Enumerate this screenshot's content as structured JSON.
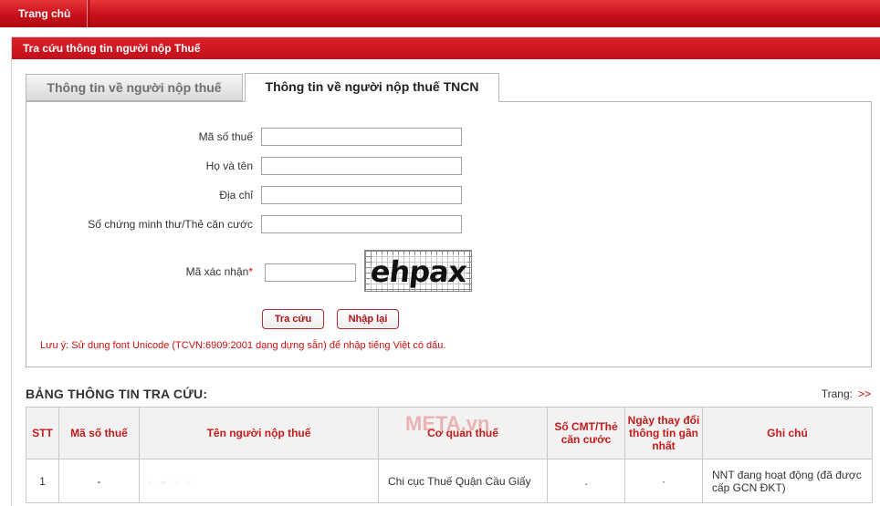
{
  "topnav": {
    "home_label": "Trang chủ"
  },
  "panel": {
    "title": "Tra cứu thông tin người nộp Thuế"
  },
  "tabs": [
    {
      "label": "Thông tin về người nộp thuế",
      "active": false
    },
    {
      "label": "Thông tin về người nộp thuế TNCN",
      "active": true
    }
  ],
  "form": {
    "tax_code_label": "Mã số thuế",
    "tax_code_value": "",
    "full_name_label": "Họ và tên",
    "full_name_value": "",
    "address_label": "Địa chỉ",
    "address_value": "",
    "id_card_label": "Số chứng minh thư/Thẻ căn cước",
    "id_card_value": "",
    "captcha_label": "Mã xác nhận",
    "captcha_required_mark": "*",
    "captcha_input_value": "",
    "captcha_text": "ehpax",
    "search_button": "Tra cứu",
    "reset_button": "Nhập lại",
    "note": "Lưu ý: Sử dụng font Unicode (TCVN:6909:2001 dạng dựng sẵn) để nhập tiếng Việt có dấu."
  },
  "results": {
    "title": "BẢNG THÔNG TIN TRA CỨU:",
    "pager_label": "Trang:",
    "pager_next": ">>",
    "headers": [
      "STT",
      "Mã số thuế",
      "Tên người nộp thuế",
      "Cơ quan thuế",
      "Số CMT/Thẻ căn cước",
      "Ngày thay đổi thông tin gần nhất",
      "Ghi chú"
    ],
    "rows": [
      {
        "stt": "1",
        "tax_code": "-",
        "name": "",
        "tax_office": "Chi cục Thuế Quận Cầu Giấy",
        "id_card": ".",
        "last_changed": "·",
        "note": "NNT đang hoạt động (đã được cấp GCN ĐKT)"
      }
    ]
  },
  "watermark": "META.vn",
  "colors": {
    "brand_red": "#c8101a",
    "label_red": "#c41a1a",
    "note_red": "#c81010"
  }
}
